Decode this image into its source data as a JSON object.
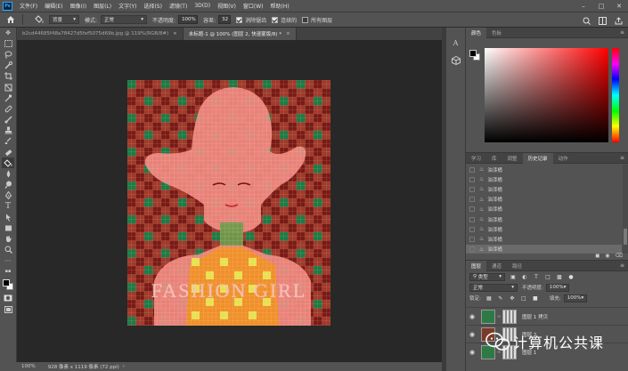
{
  "app": {
    "logo": "Ps",
    "menu": [
      "文件(F)",
      "编辑(E)",
      "图像(I)",
      "图层(L)",
      "文字(Y)",
      "选择(S)",
      "滤镜(T)",
      "3D(D)",
      "视图(V)",
      "窗口(W)",
      "帮助(H)"
    ]
  },
  "options": {
    "sample_label": "背景",
    "mode_label": "模式:",
    "mode_value": "正常",
    "opacity_label": "不透明度:",
    "opacity_value": "100%",
    "tolerance_label": "容差:",
    "tolerance_value": "32",
    "antialias_label": "消除锯齿",
    "contiguous_label": "连续的",
    "all_layers_label": "所有图层"
  },
  "tabs": [
    {
      "label": "b2cd44685f48a78427d5fef5075d69b.jpg @ 119%(RGB/8#)",
      "active": false
    },
    {
      "label": "未标题-1 @ 100% (图层 2, 快速蒙版/8) *",
      "active": true
    }
  ],
  "canvas": {
    "text": "FASHION GIRL"
  },
  "status": {
    "zoom": "100%",
    "doc_info": "928 像素 x 1119 像素 (72 ppi)"
  },
  "panels": {
    "color_tabs": [
      "颜色",
      "色板"
    ],
    "history_tabs": [
      "学习",
      "库",
      "调整",
      "历史记录",
      "动作"
    ],
    "history_item": "油漆桶",
    "history_count": 9,
    "layers_tabs": [
      "图层",
      "通道",
      "路径"
    ],
    "kind_label": "类型",
    "blend_mode": "正常",
    "opacity_label": "不透明度:",
    "opacity_value": "100%",
    "lock_label": "锁定:",
    "fill_label": "填充:",
    "fill_value": "100%",
    "layers": [
      {
        "name": "图层 1 拷贝"
      },
      {
        "name": "图层 2"
      },
      {
        "name": "图层 1"
      }
    ]
  },
  "watermark": {
    "text": "计算机公共课"
  },
  "colors": {
    "ui_bg": "#535353",
    "workspace": "#282828",
    "plaid_red": "#a03a2a",
    "plaid_green": "#1f7a45",
    "plaid_darkred": "#7a1a14",
    "plaid_pink": "#f08a80",
    "plaid_orange": "#f0902a",
    "plaid_yellow": "#e8e050"
  }
}
